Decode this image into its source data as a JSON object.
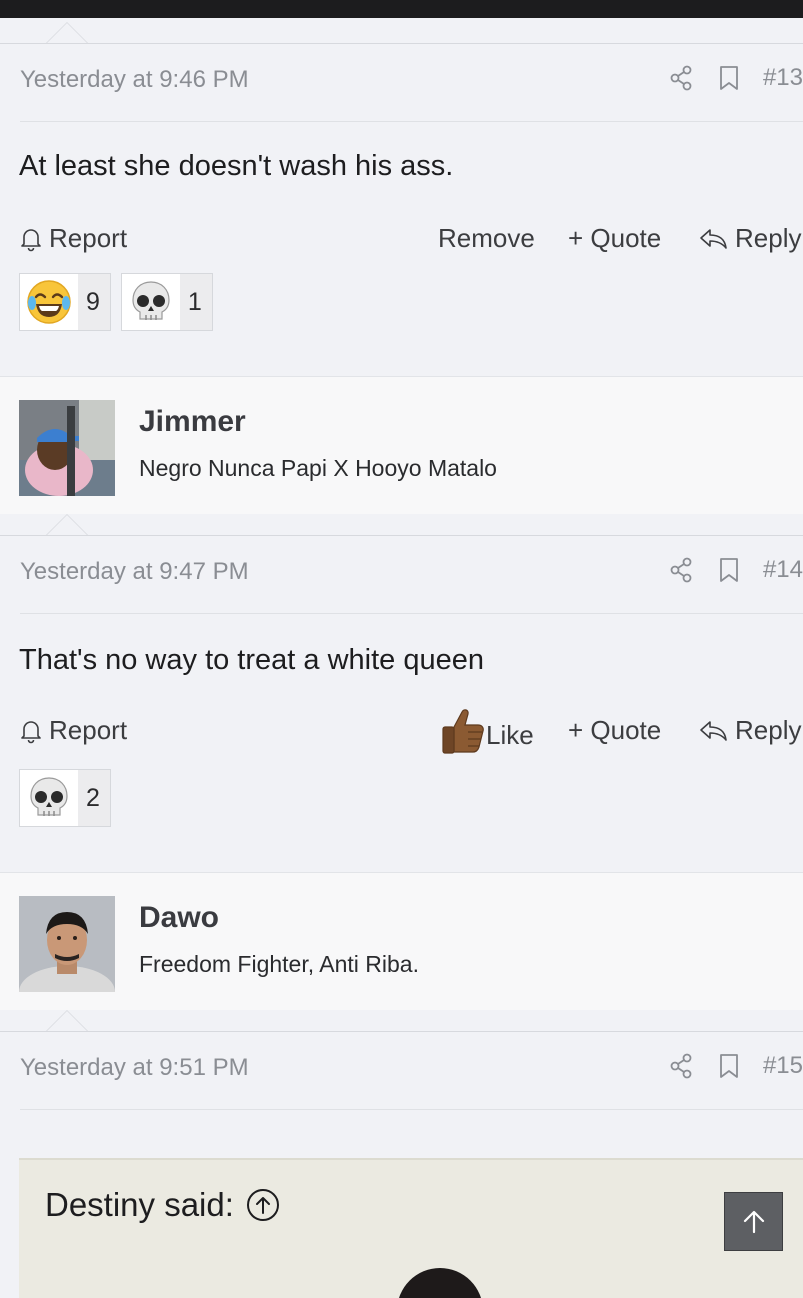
{
  "posts": [
    {
      "timestamp": "Yesterday at 9:46 PM",
      "number": "#13",
      "body": "At least she doesn't wash his ass.",
      "actions": {
        "report": "Report",
        "remove": "Remove",
        "quote": "+ Quote",
        "reply": "Reply"
      },
      "reactions": [
        {
          "emoji": "laughing-tears",
          "count": "9"
        },
        {
          "emoji": "skull",
          "count": "1"
        }
      ]
    },
    {
      "author": "Jimmer",
      "user_title": "Negro Nunca Papi X Hooyo Matalo",
      "timestamp": "Yesterday at 9:47 PM",
      "number": "#14",
      "body": "That's no way to treat a white queen",
      "actions": {
        "report": "Report",
        "like": "Like",
        "quote": "+ Quote",
        "reply": "Reply"
      },
      "reactions": [
        {
          "emoji": "skull",
          "count": "2"
        }
      ]
    },
    {
      "author": "Dawo",
      "user_title": "Freedom Fighter, Anti Riba.",
      "timestamp": "Yesterday at 9:51 PM",
      "number": "#15",
      "quote": {
        "attribution": "Destiny said:"
      }
    }
  ],
  "colors": {
    "background": "#f1f2f6",
    "meta_text": "#8a8d93",
    "quote_bg": "#ebeae1",
    "scroll_button": "#5d5f63"
  }
}
